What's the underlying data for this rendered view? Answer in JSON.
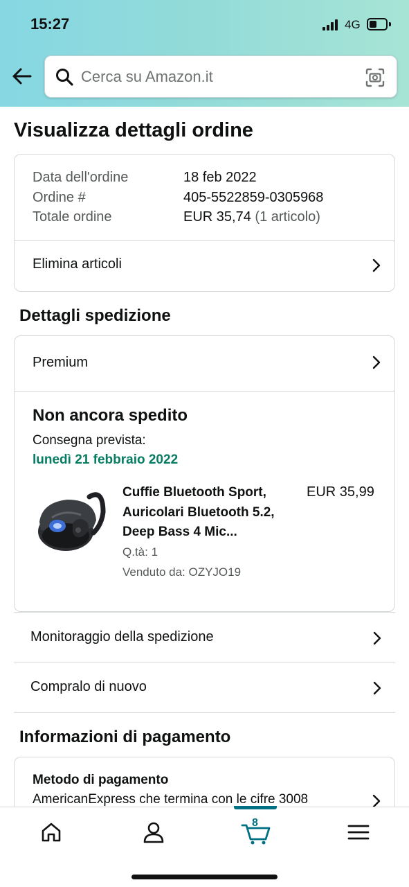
{
  "status_bar": {
    "time": "15:27",
    "network": "4G"
  },
  "search": {
    "placeholder": "Cerca su Amazon.it"
  },
  "page_title": "Visualizza dettagli ordine",
  "order_summary": {
    "date_label": "Data dell'ordine",
    "date_value": "18 feb 2022",
    "order_label": "Ordine #",
    "order_value": "405-5522859-0305968",
    "total_label": "Totale ordine",
    "total_value": "EUR 35,74",
    "total_count": "(1 articolo)",
    "delete_items": "Elimina articoli"
  },
  "shipping": {
    "section_title": "Dettagli spedizione",
    "speed": "Premium",
    "status": "Non ancora spedito",
    "delivery_label": "Consegna prevista:",
    "delivery_date": "lunedì 21 febbraio 2022",
    "product": {
      "title": "Cuffie Bluetooth Sport, Auricolari Bluetooth 5.2, Deep Bass 4 Mic...",
      "price": "EUR 35,99",
      "quantity": "Q.tà: 1",
      "seller": "Venduto da: OZYJO19"
    }
  },
  "actions": {
    "track": "Monitoraggio della spedizione",
    "buy_again": "Compralo di nuovo"
  },
  "payment": {
    "section_title": "Informazioni di pagamento",
    "method_label": "Metodo di pagamento",
    "method_value": "AmericanExpress che termina con le cifre 3008"
  },
  "bottom_nav": {
    "cart_count": "8",
    "accent_color": "#007185"
  },
  "colors": {
    "header_gradient_start": "#86d7e3",
    "header_gradient_end": "#a7e4d6",
    "delivery_green": "#067d62"
  }
}
